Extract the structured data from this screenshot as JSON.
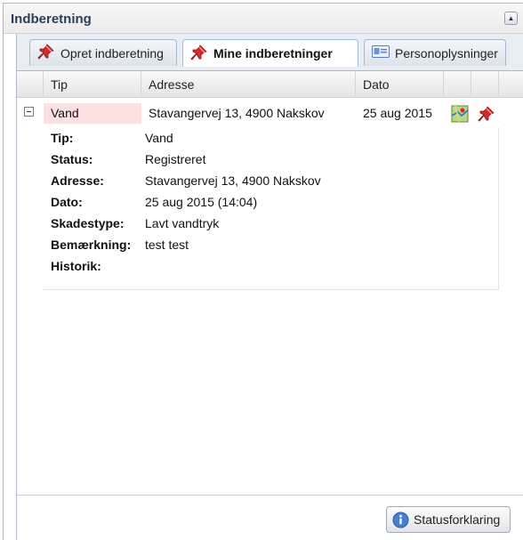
{
  "panel": {
    "title": "Indberetning"
  },
  "tabs": [
    {
      "label": "Opret indberetning",
      "icon": "pushpin-icon"
    },
    {
      "label": "Mine indberetninger",
      "icon": "pushpin-icon",
      "active": true
    },
    {
      "label": "Personoplysninger",
      "icon": "id-card-icon"
    }
  ],
  "grid": {
    "columns": [
      "Tip",
      "Adresse",
      "Dato"
    ],
    "row": {
      "tip": "Vand",
      "adresse": "Stavangervej 13, 4900 Nakskov",
      "dato": "25 aug 2015"
    },
    "details": [
      {
        "label": "Tip:",
        "value": "Vand"
      },
      {
        "label": "Status:",
        "value": "Registreret"
      },
      {
        "label": "Adresse:",
        "value": "Stavangervej 13, 4900 Nakskov"
      },
      {
        "label": "Dato:",
        "value": "25 aug 2015 (14:04)"
      },
      {
        "label": "Skadestype:",
        "value": "Lavt vandtryk"
      },
      {
        "label": "Bemærkning:",
        "value": "test test"
      },
      {
        "label": "Historik:",
        "value": ""
      }
    ]
  },
  "footer": {
    "status_button": "Statusforklaring"
  },
  "colors": {
    "accent": "#99bbe8",
    "row_highlight": "#fbe1e1",
    "pin_red": "#d42a2a"
  }
}
